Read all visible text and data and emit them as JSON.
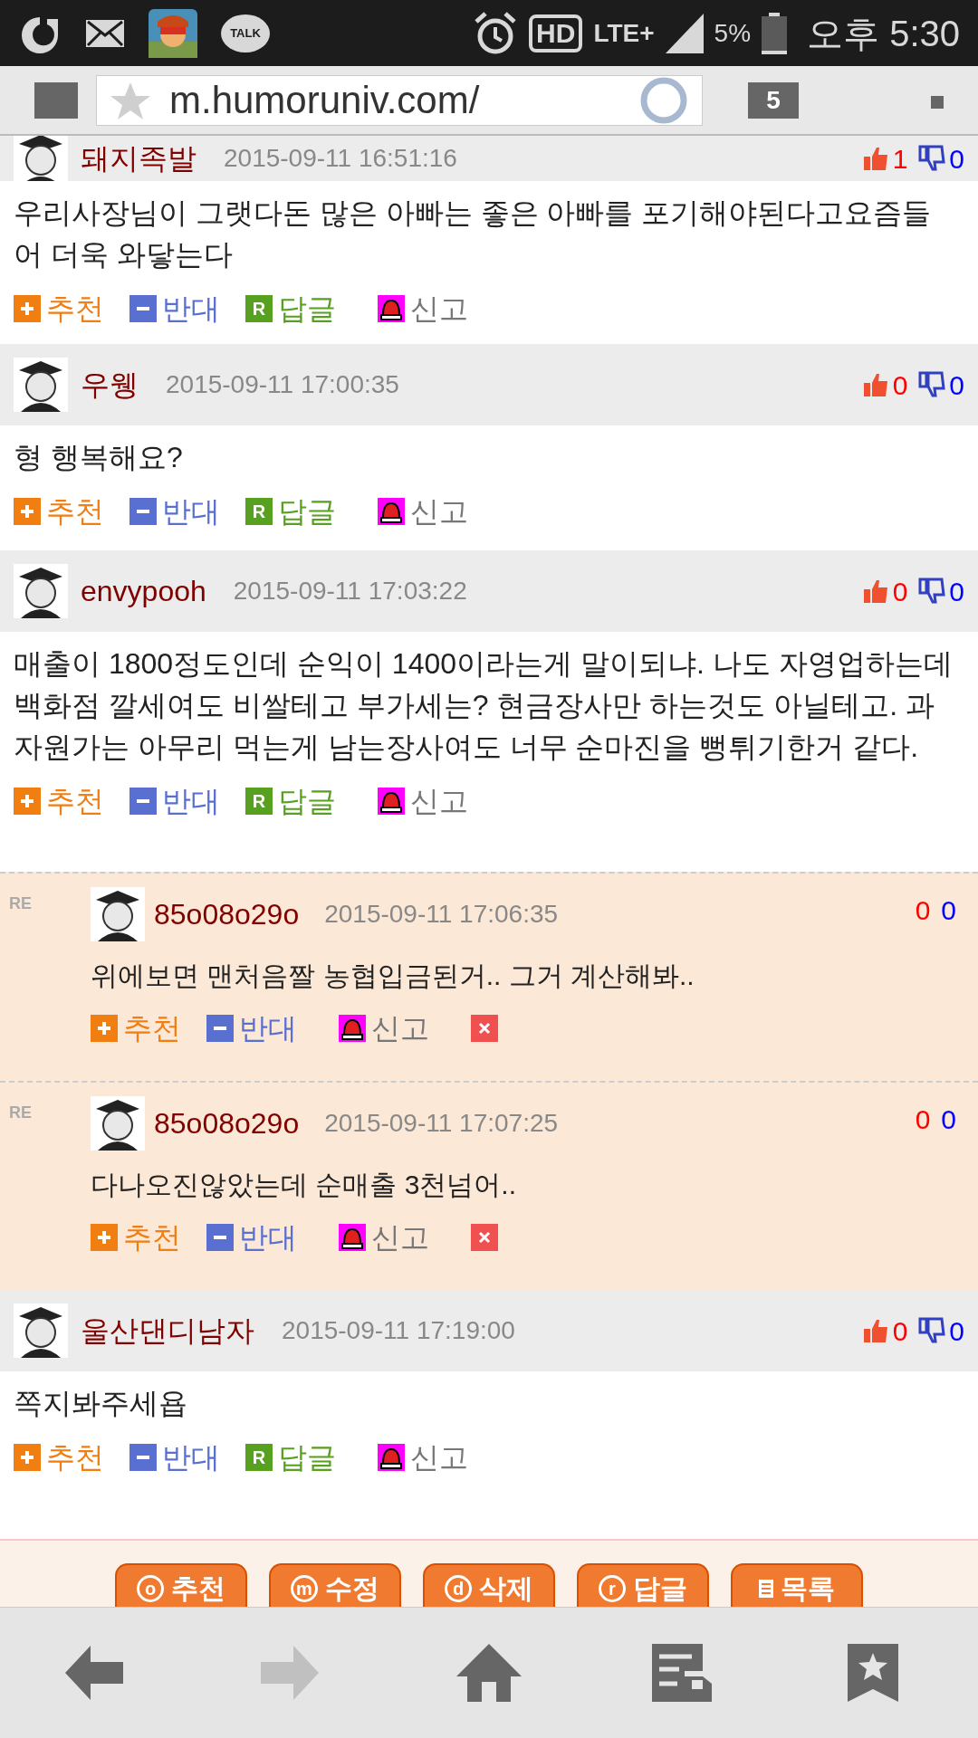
{
  "status_bar": {
    "talk_label": "TALK",
    "hd_label": "HD",
    "network": "LTE+",
    "battery": "5%",
    "time": "오후 5:30"
  },
  "browser_bar": {
    "url": "m.humoruniv.com/",
    "tab_count": "5"
  },
  "comments": [
    {
      "kind": "comment",
      "author": "돼지족발",
      "date": "2015-09-11 16:51:16",
      "likes": "1",
      "dislikes": "0",
      "text": "우리사장님이 그랫다돈 많은 아빠는 좋은 아빠를 포기해야된다고요즘들어 더욱 와닿는다",
      "actions": [
        {
          "kind": "recommend",
          "label": "추천"
        },
        {
          "kind": "oppose",
          "label": "반대"
        },
        {
          "kind": "reply",
          "badge": "R",
          "label": "답글"
        },
        {
          "kind": "report",
          "label": "신고"
        }
      ]
    },
    {
      "kind": "comment",
      "author": "우웽",
      "date": "2015-09-11 17:00:35",
      "likes": "0",
      "dislikes": "0",
      "text": "형 행복해요?",
      "actions": [
        {
          "kind": "recommend",
          "label": "추천"
        },
        {
          "kind": "oppose",
          "label": "반대"
        },
        {
          "kind": "reply",
          "badge": "R",
          "label": "답글"
        },
        {
          "kind": "report",
          "label": "신고"
        }
      ]
    },
    {
      "kind": "comment",
      "author": "envypooh",
      "date": "2015-09-11 17:03:22",
      "likes": "0",
      "dislikes": "0",
      "text": "매출이 1800정도인데 순익이 1400이라는게 말이되냐. 나도 자영업하는데 백화점 깔세여도 비쌀테고 부가세는? 현금장사만 하는것도 아닐테고. 과자원가는 아무리 먹는게 남는장사여도 너무 순마진을 뻥튀기한거 같다.",
      "actions": [
        {
          "kind": "recommend",
          "label": "추천"
        },
        {
          "kind": "oppose",
          "label": "반대"
        },
        {
          "kind": "reply",
          "badge": "R",
          "label": "답글"
        },
        {
          "kind": "report",
          "label": "신고"
        }
      ]
    },
    {
      "kind": "reply",
      "marker": "RE",
      "author": "85o08o29o",
      "date": "2015-09-11 17:06:35",
      "likes": "0",
      "dislikes": "0",
      "text": "위에보면 맨처음짤 농협입금된거.. 그거 계산해봐..",
      "actions": [
        {
          "kind": "recommend",
          "label": "추천"
        },
        {
          "kind": "oppose",
          "label": "반대"
        },
        {
          "kind": "report",
          "label": "신고"
        },
        {
          "kind": "delete"
        }
      ]
    },
    {
      "kind": "reply",
      "marker": "RE",
      "author": "85o08o29o",
      "date": "2015-09-11 17:07:25",
      "likes": "0",
      "dislikes": "0",
      "text": "다나오진않았는데 순매출 3천넘어..",
      "actions": [
        {
          "kind": "recommend",
          "label": "추천"
        },
        {
          "kind": "oppose",
          "label": "반대"
        },
        {
          "kind": "report",
          "label": "신고"
        },
        {
          "kind": "delete"
        }
      ]
    },
    {
      "kind": "comment",
      "author": "울산댄디남자",
      "date": "2015-09-11 17:19:00",
      "likes": "0",
      "dislikes": "0",
      "text": "쪽지봐주세욥",
      "actions": [
        {
          "kind": "recommend",
          "label": "추천"
        },
        {
          "kind": "oppose",
          "label": "반대"
        },
        {
          "kind": "reply",
          "badge": "R",
          "label": "답글"
        },
        {
          "kind": "report",
          "label": "신고"
        }
      ]
    }
  ],
  "bottom_buttons": [
    {
      "kind": "symbol",
      "symbol": "o",
      "label": "추천"
    },
    {
      "kind": "symbol",
      "symbol": "m",
      "label": "수정"
    },
    {
      "kind": "symbol",
      "symbol": "d",
      "label": "삭제"
    },
    {
      "kind": "symbol",
      "symbol": "r",
      "label": "답글"
    },
    {
      "kind": "list",
      "label": "목록"
    }
  ],
  "nav": [
    {
      "kind": "back",
      "disabled": false
    },
    {
      "kind": "forward",
      "disabled": true
    },
    {
      "kind": "home",
      "disabled": false
    },
    {
      "kind": "tabs",
      "disabled": false
    },
    {
      "kind": "bookmarks",
      "disabled": false
    }
  ]
}
